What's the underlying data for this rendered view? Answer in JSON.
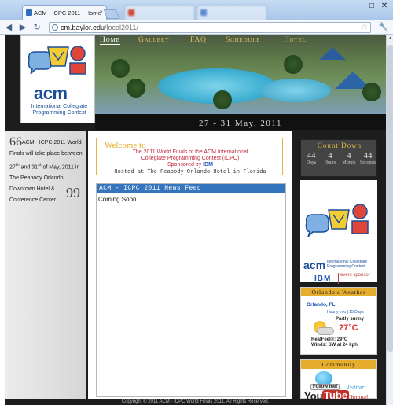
{
  "browser": {
    "tab_title": "ACM - ICPC 2011 | Home",
    "tab_close": "×",
    "url_host": "cm.baylor.edu",
    "url_path": "/local2011/",
    "back": "◀",
    "forward": "▶",
    "reload": "↻",
    "star": "☆",
    "wrench": "🔧",
    "minimize": "–",
    "maximize": "□",
    "close": "✕",
    "blurred_tab_1": "",
    "blurred_tab_2": ""
  },
  "nav": {
    "items": [
      "Home",
      "Gallery",
      "FAQ",
      "Schedule",
      "Hotel"
    ],
    "active": "Home"
  },
  "header": {
    "date": "27 - 31 May, 2011",
    "logo_text": "acm",
    "logo_sub": "International Collegiate Programming Contest"
  },
  "quote": {
    "open": "66",
    "text_1": "ACM - ICPC 2011 World Finals will take place between 27",
    "sup_1": "th",
    "text_2": " and 31",
    "sup_2": "st",
    "text_3": " of May, 2011 in The Peabody Orlando Downtown Hotel & Conference Center.",
    "close": "99"
  },
  "welcome": {
    "title": "Welcome to",
    "line1": "The 2011 World Finals of the ACM International",
    "line2": "Collegiate Programming Contest (ICPC)",
    "line3_prefix": "Sponsored by",
    "line3_sponsor": "IBM",
    "line4": "Hosted at The Peabody Orlando Hotel in Florida"
  },
  "news": {
    "header": "ACM - ICPC 2011 News Feed",
    "body": "Coming Soon"
  },
  "countdown": {
    "title": "Count Down",
    "cells": [
      {
        "value": "44",
        "unit": "Days"
      },
      {
        "value": "4",
        "unit": "Hours"
      },
      {
        "value": "4",
        "unit": "Minute"
      },
      {
        "value": "44",
        "unit": "Seconds"
      }
    ]
  },
  "sponsor": {
    "acm": "acm",
    "acm_sub": "International Collegiate Programming Contest",
    "ibm": "IBM",
    "event_sponsor": "event sponsor"
  },
  "weather": {
    "title": "Orlando's Weather",
    "city": "Orlando, FL",
    "links": "Hourly Info | 15 Days",
    "condition": "Partly sunny",
    "temp": "27°C",
    "realfeel": "RealFeel®: 29°C",
    "wind": "Winds: SW at 24 kph"
  },
  "community": {
    "title": "Community",
    "followme": "Follow me!",
    "twitter": "Twitter",
    "yt_you": "You",
    "yt_tube": "Tube",
    "channel": "Channel"
  },
  "footer": {
    "text": "Copyright © 2011 ACM - ICPC World Finals 2011. All Rights Reserved."
  }
}
